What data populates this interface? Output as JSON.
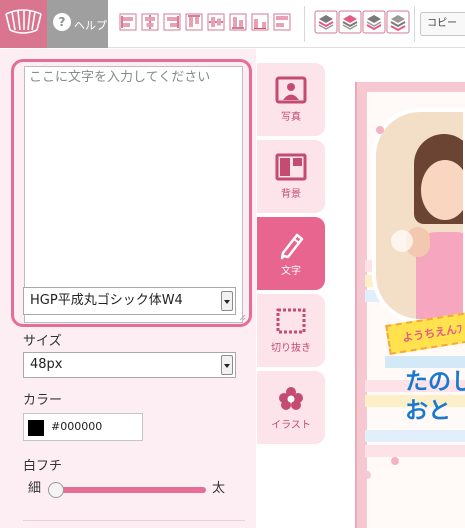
{
  "toolbar": {
    "help_label": "ヘルプ",
    "copy_label": "コピー"
  },
  "text_panel": {
    "textarea_placeholder": "ここに文字を入力してください",
    "font_select": "HGP平成丸ゴシック体W4",
    "size_label": "サイズ",
    "size_value": "48px",
    "color_label": "カラー",
    "color_value": "#000000",
    "outline_label": "白フチ",
    "outline_min_label": "細",
    "outline_max_label": "太",
    "outline_level": 0
  },
  "tabs": [
    {
      "label": "写真",
      "icon": "photo-icon",
      "active": false
    },
    {
      "label": "背景",
      "icon": "background-icon",
      "active": false
    },
    {
      "label": "文字",
      "icon": "pencil-icon",
      "active": true
    },
    {
      "label": "切り抜き",
      "icon": "crop-frame-icon",
      "active": false
    },
    {
      "label": "イラスト",
      "icon": "flower-icon",
      "active": false
    }
  ],
  "colors": {
    "accent": "#e8658f",
    "tab_inactive": "#fde3ea",
    "panel_bg": "#fceef2",
    "logo_bg": "#d9758f",
    "help_bg": "#9f9f9f"
  },
  "preview": {
    "ticket_text": "ようちえんﾌ",
    "heading_line1": "たのし",
    "heading_line2": "おと"
  }
}
